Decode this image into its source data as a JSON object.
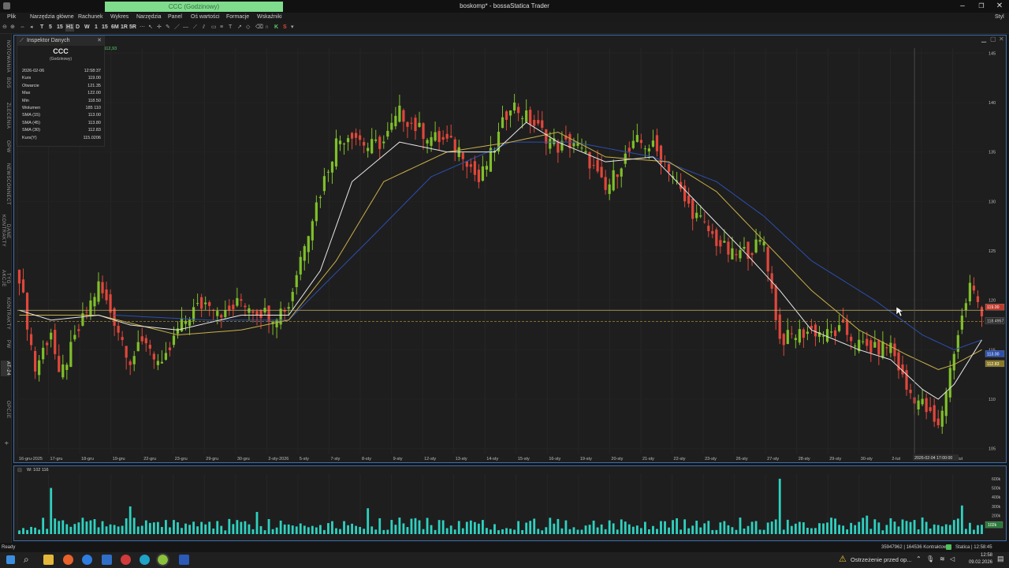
{
  "window": {
    "title": "boskomp* - bossaStatica Trader",
    "ticker_box": "CCC (Godzinowy)",
    "user_label": "Styl",
    "min_icon": "minimize-icon",
    "max_icon": "maximize-icon",
    "close_icon": "close-icon"
  },
  "menu": [
    "Plik",
    "Narzędzia główne",
    "Rachunek",
    "Wykres",
    "Narzędzia",
    "Panel",
    "Oś wartości",
    "Formacje",
    "Wskaźniki"
  ],
  "toolbar": {
    "intervals": [
      "T",
      "5",
      "15",
      "H1",
      "D",
      "W",
      "1",
      "15",
      "6M",
      "1R",
      "5R"
    ],
    "buttons": [
      "K",
      "S"
    ]
  },
  "left_tabs": [
    "NOTOWANIA",
    "BOS",
    "ZLECENIA",
    "OPW",
    "NEWSCONNECT",
    "DANE KONTRAKTY",
    "TYG AKCJE",
    "KONTRAKTY",
    "PW",
    "AT-24",
    "OPCJE"
  ],
  "inspector": {
    "title": "Inspektor Danych",
    "symbol": "CCC",
    "interval": "(Godzinowy)",
    "rows": [
      {
        "label": "2026-02-06",
        "value": "12:58:37"
      },
      {
        "label": "Kurs",
        "value": "119.00"
      },
      {
        "label": "Otwarcie",
        "value": "121.35"
      },
      {
        "label": "Max",
        "value": "122.00"
      },
      {
        "label": "Min",
        "value": "118.50"
      },
      {
        "label": "Wolumen",
        "value": "185 110"
      },
      {
        "label": "SMA (15)",
        "value": "113.00"
      },
      {
        "label": "SMA (45)",
        "value": "113.80"
      },
      {
        "label": "SMA (30)",
        "value": "112.83"
      },
      {
        "label": "Kurs(Y)",
        "value": "115.0206"
      }
    ]
  },
  "chart_panel": {
    "legend_text": "A: 112,93",
    "price_marker_red": "119.00",
    "price_marker_cursor": "118.4957",
    "ma_markers": [
      "113.00",
      "112.83"
    ],
    "crosshair_date": "2026-02-04 17:00:00"
  },
  "volume_panel": {
    "legend_text": "W: 102 116",
    "ticks": [
      "600k",
      "500k",
      "400k",
      "300k",
      "200k",
      "100k"
    ],
    "last_marker": "102k"
  },
  "statusbar": {
    "left": "Ready",
    "center": "35947962 | 164536 Kontraktowy",
    "right": "Statica | 12:58:45"
  },
  "taskbar": {
    "notification": "Ostrzeżenie przed op...",
    "time": "12:58",
    "date": "09.02.2026"
  },
  "colors": {
    "up": "#7fbf2a",
    "down": "#e0473b",
    "sma_fast": "#e8e8e8",
    "sma_mid": "#c9b04a",
    "sma_slow": "#2c4fb0",
    "volume": "#2fd1c0",
    "accent": "#3b6fb0"
  },
  "chart_data": {
    "type": "candlestick",
    "y_ticks": [
      145,
      140,
      135,
      130,
      125,
      120,
      115,
      110,
      105
    ],
    "ylim": [
      104.5,
      145.5
    ],
    "x_labels": [
      "16-gru-2025",
      "17-gru",
      "18-gru",
      "19-gru",
      "22-gru",
      "23-gru",
      "29-gru",
      "30-gru",
      "2-sty-2026",
      "5-sty",
      "7-sty",
      "8-sty",
      "9-sty",
      "12-sty",
      "13-sty",
      "14-sty",
      "15-sty",
      "16-sty",
      "19-sty",
      "20-sty",
      "21-sty",
      "22-sty",
      "23-sty",
      "26-sty",
      "27-sty",
      "28-sty",
      "29-sty",
      "30-sty",
      "2-lut",
      "3-lut",
      "4-lut"
    ],
    "close_anchors": [
      [
        0,
        122.5
      ],
      [
        4,
        113
      ],
      [
        8,
        117
      ],
      [
        10,
        112
      ],
      [
        16,
        118
      ],
      [
        20,
        121.5
      ],
      [
        24,
        118
      ],
      [
        28,
        114
      ],
      [
        32,
        116
      ],
      [
        36,
        113
      ],
      [
        40,
        117
      ],
      [
        44,
        119
      ],
      [
        48,
        120
      ],
      [
        52,
        118.5
      ],
      [
        56,
        120
      ],
      [
        60,
        119
      ],
      [
        64,
        118.5
      ],
      [
        68,
        119.5
      ],
      [
        72,
        126
      ],
      [
        76,
        131
      ],
      [
        80,
        136
      ],
      [
        84,
        137
      ],
      [
        88,
        135.5
      ],
      [
        92,
        136
      ],
      [
        96,
        139
      ],
      [
        100,
        137.5
      ],
      [
        104,
        136.5
      ],
      [
        108,
        136
      ],
      [
        112,
        135
      ],
      [
        116,
        132
      ],
      [
        120,
        135.5
      ],
      [
        124,
        140
      ],
      [
        128,
        138.5
      ],
      [
        132,
        137
      ],
      [
        136,
        135.5
      ],
      [
        140,
        136
      ],
      [
        144,
        134
      ],
      [
        148,
        131
      ],
      [
        152,
        134
      ],
      [
        156,
        136
      ],
      [
        160,
        135.5
      ],
      [
        164,
        133.5
      ],
      [
        168,
        130
      ],
      [
        172,
        128
      ],
      [
        176,
        126
      ],
      [
        180,
        124.5
      ],
      [
        184,
        125
      ],
      [
        188,
        126
      ],
      [
        192,
        116
      ],
      [
        196,
        116.5
      ],
      [
        200,
        117
      ],
      [
        204,
        116.5
      ],
      [
        208,
        117
      ],
      [
        212,
        115.5
      ],
      [
        216,
        115
      ],
      [
        220,
        115.5
      ],
      [
        224,
        111
      ],
      [
        228,
        109.5
      ],
      [
        232,
        107
      ],
      [
        236,
        115
      ],
      [
        240,
        121.5
      ],
      [
        243,
        119
      ]
    ],
    "sma_fast_anchors": [
      [
        0,
        119
      ],
      [
        8,
        118
      ],
      [
        20,
        118.5
      ],
      [
        28,
        117.5
      ],
      [
        40,
        117
      ],
      [
        56,
        118.5
      ],
      [
        68,
        118.5
      ],
      [
        76,
        123
      ],
      [
        84,
        132
      ],
      [
        96,
        136
      ],
      [
        108,
        135
      ],
      [
        120,
        135
      ],
      [
        128,
        138
      ],
      [
        136,
        136
      ],
      [
        148,
        134
      ],
      [
        160,
        134.5
      ],
      [
        172,
        129.5
      ],
      [
        184,
        124.5
      ],
      [
        192,
        121
      ],
      [
        200,
        117
      ],
      [
        212,
        115
      ],
      [
        220,
        114
      ],
      [
        228,
        111
      ],
      [
        232,
        110
      ],
      [
        236,
        111.5
      ],
      [
        243,
        116
      ]
    ],
    "sma_mid_anchors": [
      [
        0,
        118.5
      ],
      [
        20,
        118.5
      ],
      [
        40,
        116.5
      ],
      [
        56,
        117
      ],
      [
        68,
        118
      ],
      [
        80,
        124
      ],
      [
        92,
        132
      ],
      [
        108,
        135
      ],
      [
        124,
        136
      ],
      [
        136,
        137
      ],
      [
        148,
        134.5
      ],
      [
        164,
        134
      ],
      [
        176,
        131
      ],
      [
        188,
        126
      ],
      [
        200,
        121
      ],
      [
        212,
        117
      ],
      [
        224,
        114.5
      ],
      [
        232,
        113
      ],
      [
        236,
        113.5
      ],
      [
        243,
        115
      ]
    ],
    "sma_slow_anchors": [
      [
        24,
        118.5
      ],
      [
        48,
        118
      ],
      [
        68,
        118
      ],
      [
        88,
        126
      ],
      [
        104,
        132.5
      ],
      [
        124,
        136
      ],
      [
        140,
        136
      ],
      [
        160,
        134.5
      ],
      [
        176,
        132
      ],
      [
        188,
        128.5
      ],
      [
        200,
        124
      ],
      [
        216,
        120
      ],
      [
        228,
        116.5
      ],
      [
        236,
        115
      ],
      [
        243,
        116
      ]
    ],
    "volume_spikes": [
      [
        8,
        500
      ],
      [
        28,
        300
      ],
      [
        60,
        240
      ],
      [
        88,
        280
      ],
      [
        192,
        600
      ],
      [
        214,
        200
      ],
      [
        228,
        180
      ],
      [
        238,
        310
      ]
    ],
    "volume_max": 650
  }
}
